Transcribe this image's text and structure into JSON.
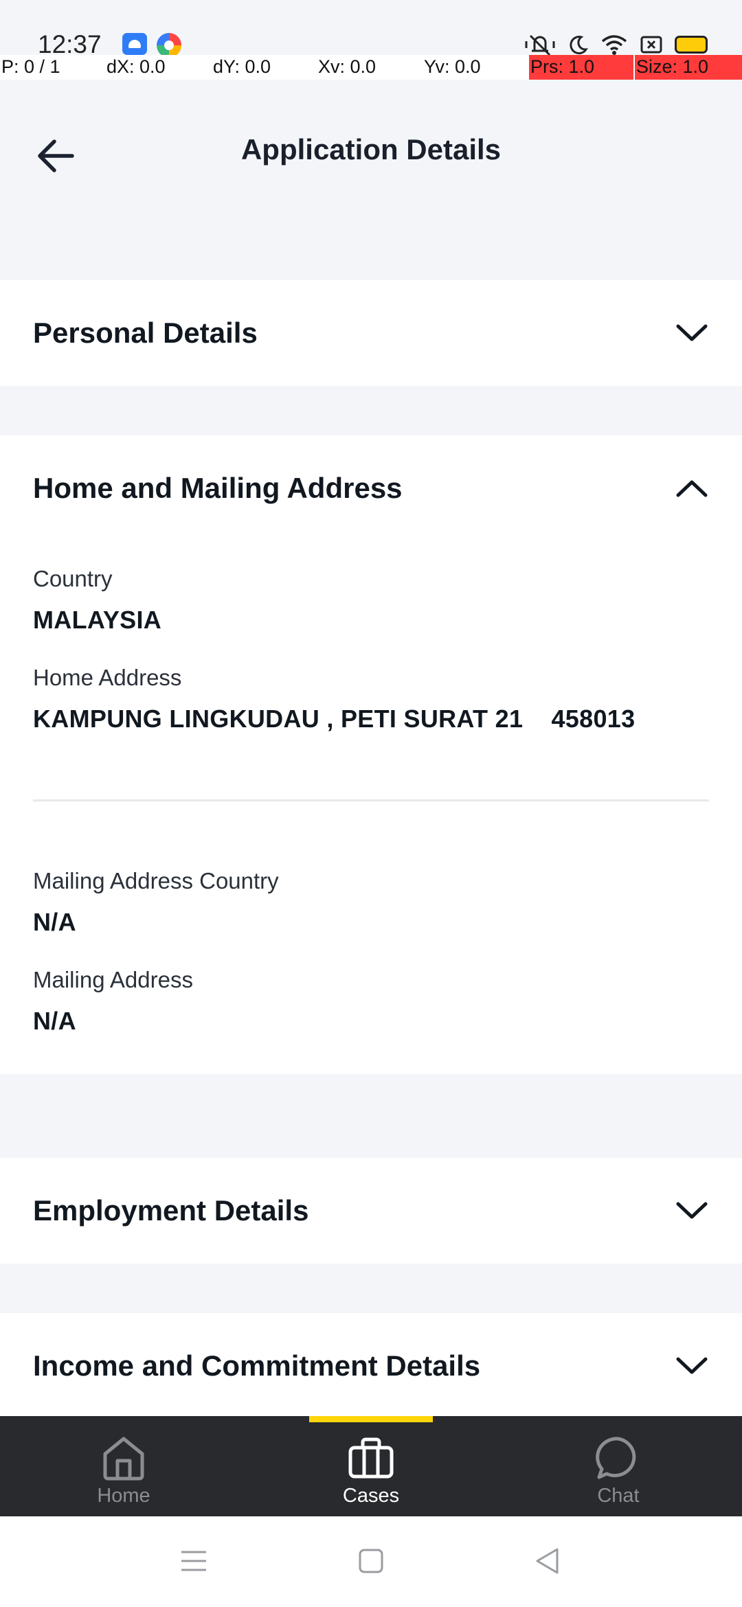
{
  "status_bar": {
    "time": "12:37",
    "icons": [
      "app-notification-icon",
      "browser-notification-icon",
      "mute-icon",
      "do-not-disturb-icon",
      "wifi-icon",
      "screenshot-icon",
      "battery-icon"
    ]
  },
  "debug_overlay": {
    "pointer": "P: 0 / 1",
    "dx": "dX: 0.0",
    "dy": "dY: 0.0",
    "xv": "Xv: 0.0",
    "yv": "Yv: 0.0",
    "prs": "Prs: 1.0",
    "size": "Size: 1.0",
    "highlight_color": "#ff3b3b"
  },
  "header": {
    "title": "Application Details",
    "back_icon": "arrow-left-icon"
  },
  "sections": {
    "personal": {
      "title": "Personal Details",
      "expanded": false
    },
    "address": {
      "title": "Home and Mailing Address",
      "expanded": true,
      "country_label": "Country",
      "country_value": "MALAYSIA",
      "home_address_label": "Home Address",
      "home_address_value": "KAMPUNG LINGKUDAU , PETI SURAT 21    458013",
      "mailing_country_label": "Mailing Address Country",
      "mailing_country_value": "N/A",
      "mailing_address_label": "Mailing Address",
      "mailing_address_value": "N/A"
    },
    "employment": {
      "title": "Employment Details",
      "expanded": false
    },
    "income": {
      "title": "Income and Commitment Details",
      "expanded": false
    }
  },
  "bottom_nav": {
    "items": [
      {
        "label": "Home",
        "icon": "home-icon",
        "active": false
      },
      {
        "label": "Cases",
        "icon": "briefcase-icon",
        "active": true
      },
      {
        "label": "Chat",
        "icon": "chat-bubble-icon",
        "active": false
      }
    ],
    "accent": "#ffd60a",
    "background": "#282a2e"
  },
  "colors": {
    "page_background": "#f4f5f9",
    "card_background": "#ffffff",
    "text_primary": "#111820"
  }
}
